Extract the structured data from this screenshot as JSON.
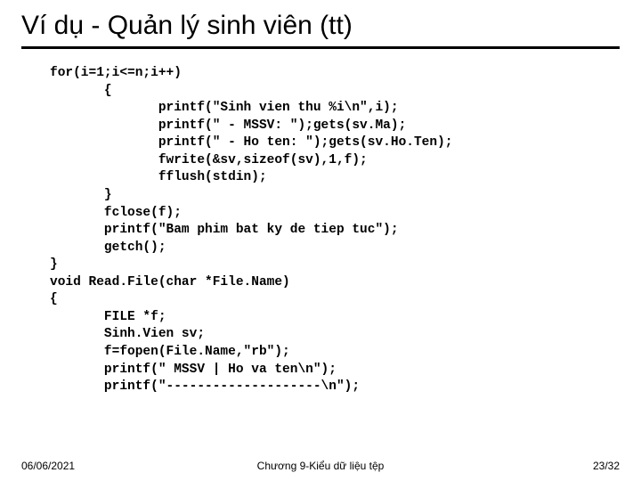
{
  "slide": {
    "title": "Ví dụ - Quản lý sinh viên (tt)",
    "code": "for(i=1;i<=n;i++)\n       {\n              printf(\"Sinh vien thu %i\\n\",i);\n              printf(\" - MSSV: \");gets(sv.Ma);\n              printf(\" - Ho ten: \");gets(sv.Ho.Ten);\n              fwrite(&sv,sizeof(sv),1,f);\n              fflush(stdin);\n       }\n       fclose(f);\n       printf(\"Bam phim bat ky de tiep tuc\");\n       getch();\n}\nvoid Read.File(char *File.Name)\n{\n       FILE *f;\n       Sinh.Vien sv;\n       f=fopen(File.Name,\"rb\");\n       printf(\" MSSV | Ho va ten\\n\");\n       printf(\"--------------------\\n\");"
  },
  "footer": {
    "date": "06/06/2021",
    "chapter": "Chương 9-Kiểu dữ liệu tệp",
    "page": "23/32"
  }
}
